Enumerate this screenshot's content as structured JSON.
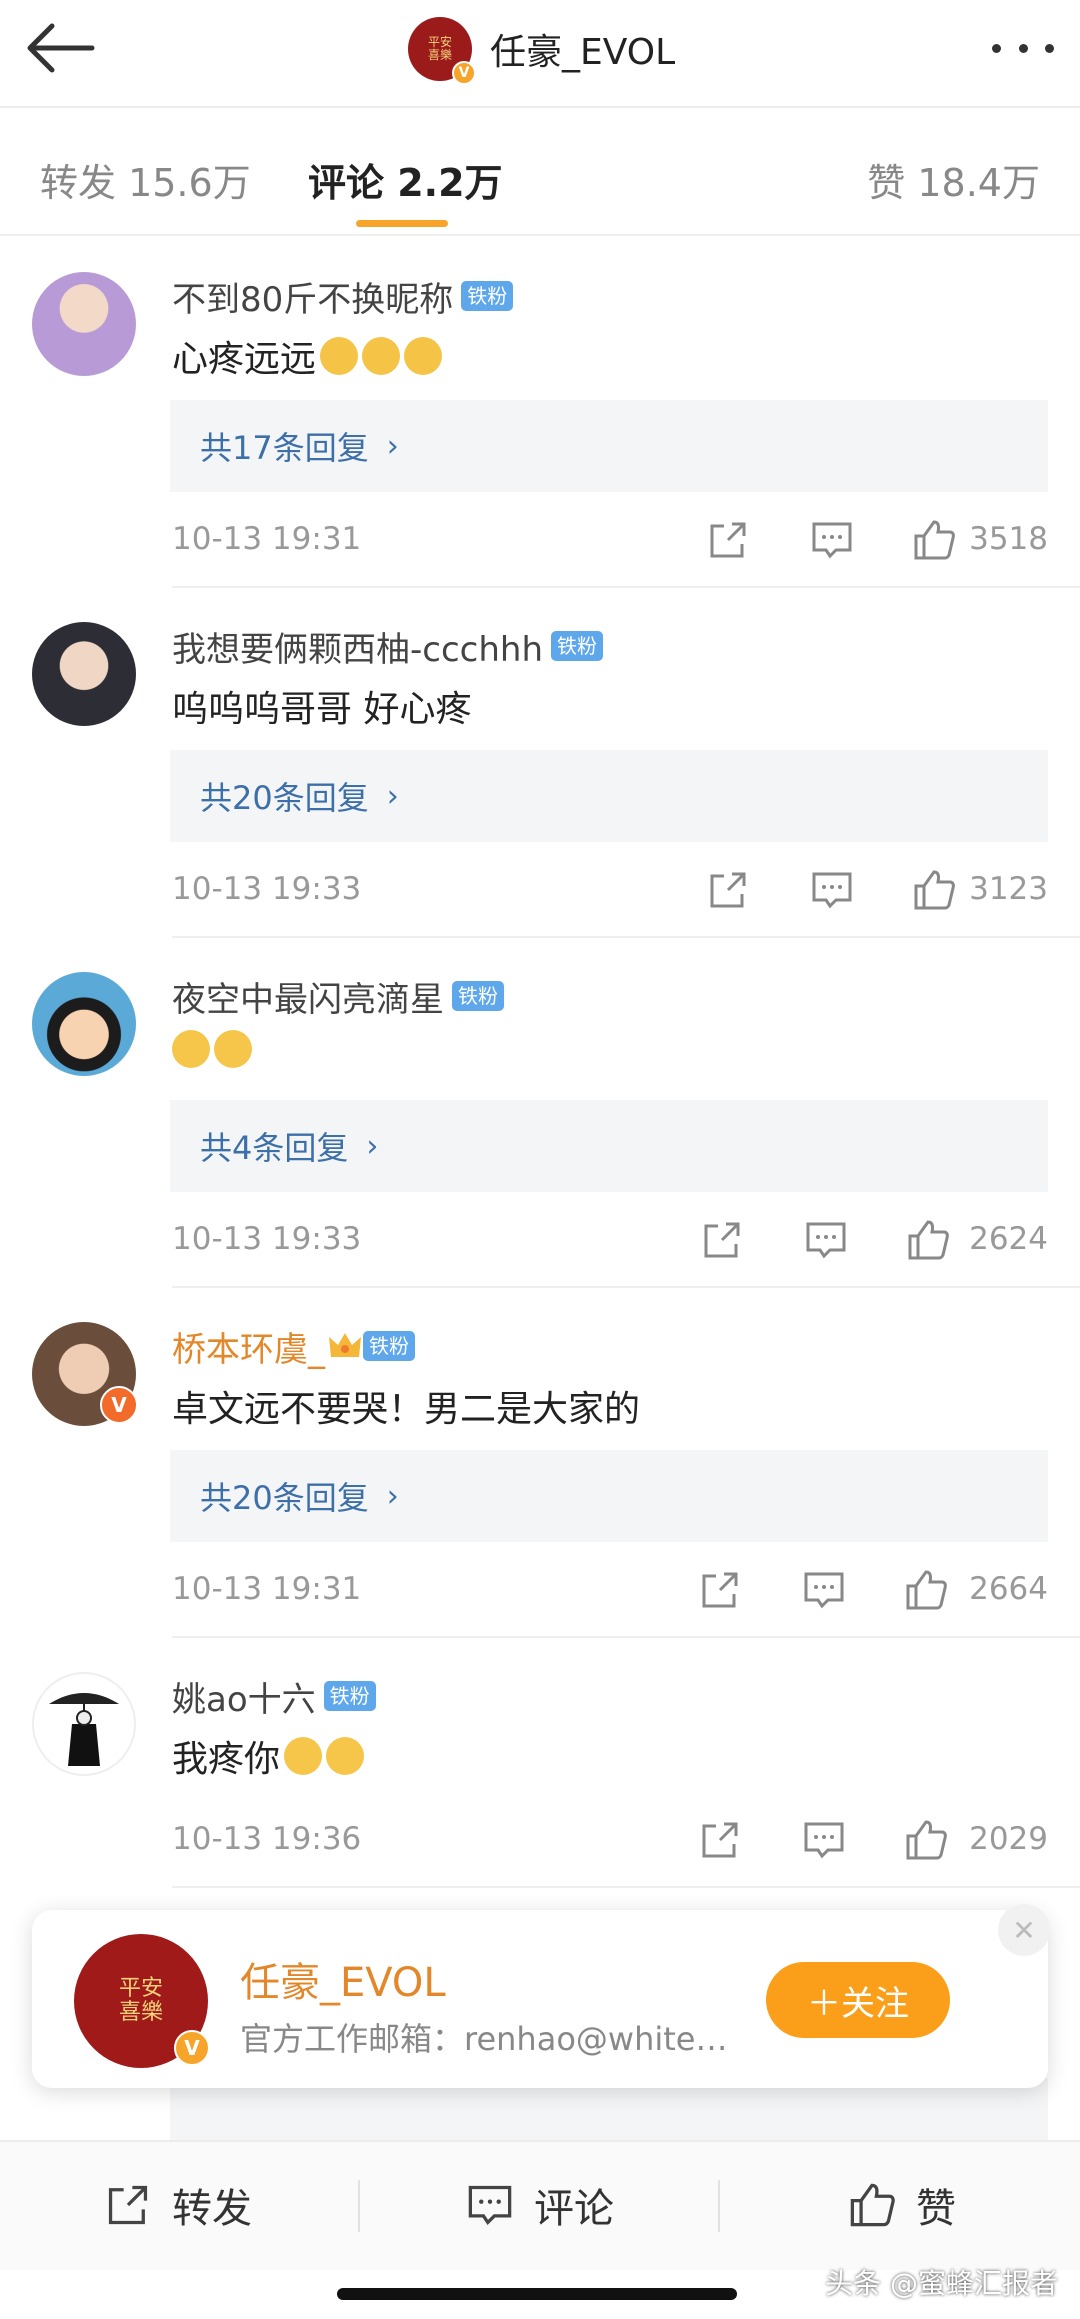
{
  "header": {
    "title": "任豪_EVOL",
    "avatar_seal": "平安喜樂",
    "verified_mark": "V"
  },
  "tabs": [
    {
      "label": "转发 15.6万",
      "active": false
    },
    {
      "label": "评论 2.2万",
      "active": true
    },
    {
      "label": "赞 18.4万",
      "active": false
    }
  ],
  "comments": [
    {
      "user": "不到80斤不换昵称",
      "badge": "铁粉",
      "text": "心疼远远",
      "emoji_count": 3,
      "replies": "共17条回复",
      "time": "10-13 19:31",
      "likes": "3518"
    },
    {
      "user": "我想要俩颗西柚-ccchhh",
      "badge": "铁粉",
      "text": "呜呜呜哥哥 好心疼",
      "emoji_count": 0,
      "replies": "共20条回复",
      "time": "10-13 19:33",
      "likes": "3123"
    },
    {
      "user": "夜空中最闪亮滴星",
      "badge": "铁粉",
      "text": "",
      "emoji_count": 2,
      "replies": "共4条回复",
      "time": "10-13 19:33",
      "likes": "2624"
    },
    {
      "user": "桥本环虞_",
      "badge": "铁粉",
      "text": "卓文远不要哭！男二是大家的",
      "emoji_count": 0,
      "replies": "共20条回复",
      "time": "10-13 19:31",
      "likes": "2664"
    },
    {
      "user": "姚ao十六",
      "badge": "铁粉",
      "text": "我疼你",
      "emoji_count": 2,
      "replies": "",
      "time": "10-13 19:36",
      "likes": "2029"
    }
  ],
  "popup": {
    "name": "任豪_EVOL",
    "desc": "官方工作邮箱：renhao@white…",
    "follow_label": "＋关注",
    "close_label": "✕",
    "avatar_seal": "平安喜樂"
  },
  "bottom_bar": {
    "repost": "转发",
    "comment": "评论",
    "like": "赞"
  },
  "watermark": "头条 @蜜蜂汇报者",
  "colors": {
    "accent": "#f7a42a",
    "link": "#3d6fa8",
    "fan_badge": "#5ea7ea",
    "gold_name": "#e3872b"
  },
  "icons": [
    "back-arrow-icon",
    "more-icon",
    "share-icon",
    "comment-icon",
    "like-icon",
    "crown-icon"
  ]
}
